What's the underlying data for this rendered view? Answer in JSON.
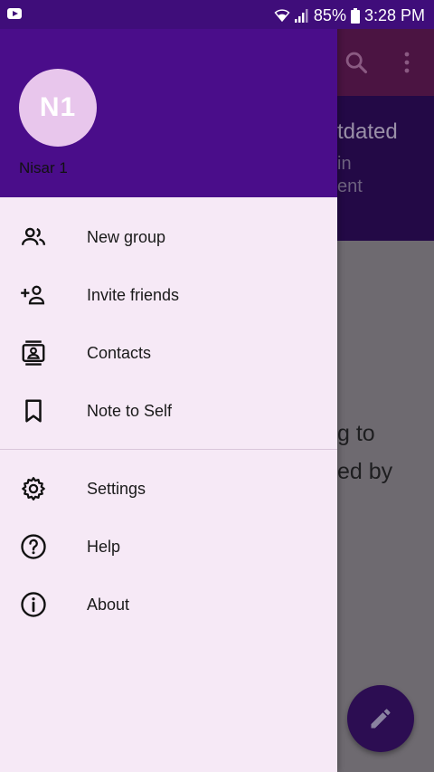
{
  "status_bar": {
    "battery": "85%",
    "time": "3:28 PM"
  },
  "drawer": {
    "header": {
      "avatar_initials": "N1",
      "user_name": "Nisar 1",
      "color": "#4a0d8a"
    },
    "items": [
      {
        "label": "New group",
        "icon": "group-icon"
      },
      {
        "label": "Invite friends",
        "icon": "add-person-icon"
      },
      {
        "label": "Contacts",
        "icon": "contacts-icon"
      },
      {
        "label": "Note to Self",
        "icon": "bookmark-icon"
      },
      {
        "label": "Settings",
        "icon": "gear-icon"
      },
      {
        "label": "Help",
        "icon": "help-icon"
      },
      {
        "label": "About",
        "icon": "info-icon"
      }
    ]
  },
  "background": {
    "banner_title": "tdated",
    "banner_line1": "in",
    "banner_line2": "ent",
    "content_line1": "g to",
    "content_line2": "ed by"
  }
}
